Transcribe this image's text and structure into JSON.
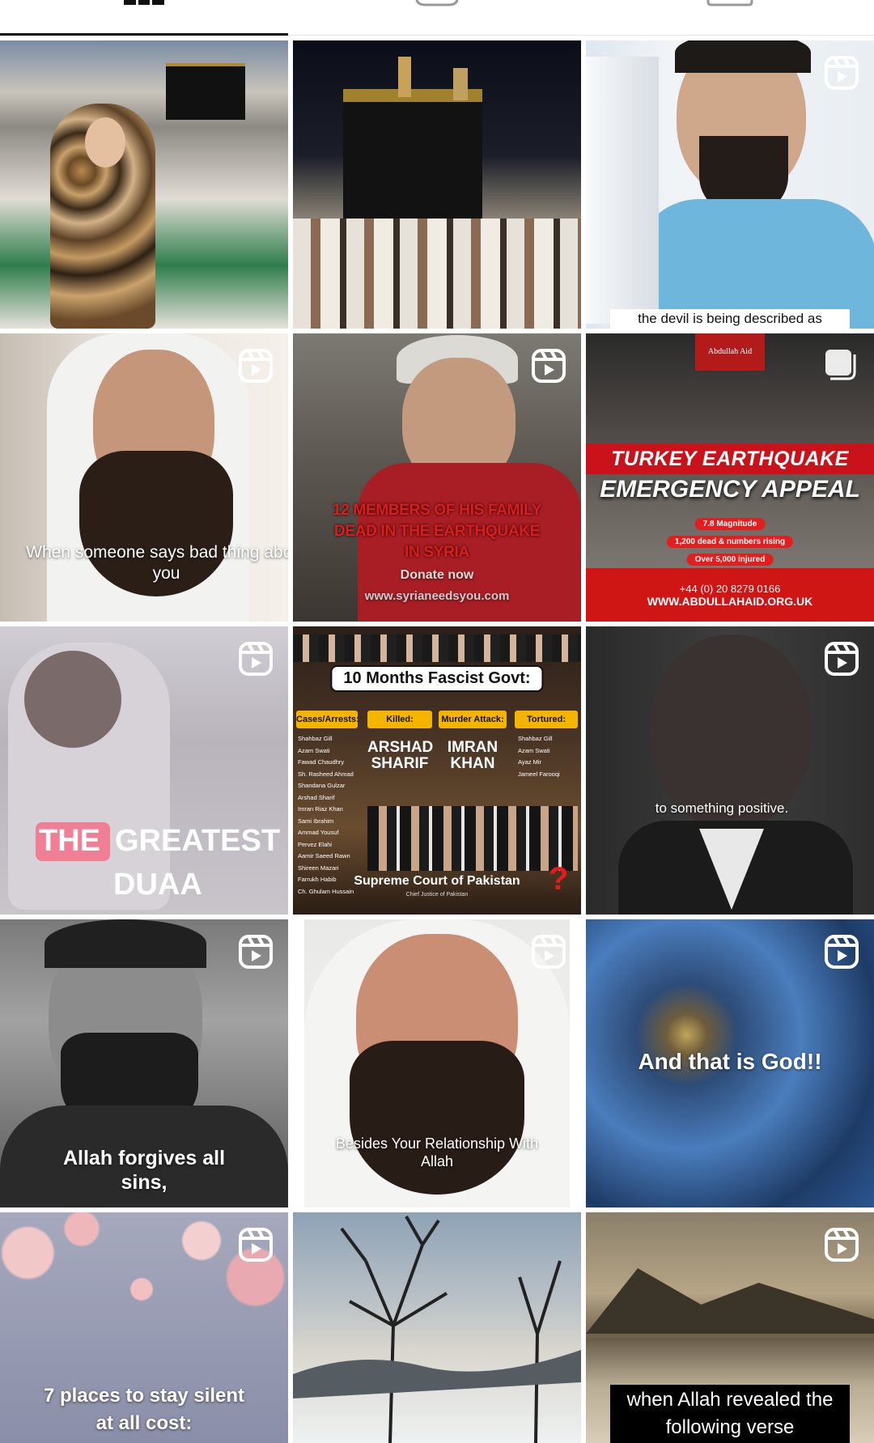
{
  "tabs": [
    {
      "name": "grid",
      "icon": "grid-icon",
      "active": true
    },
    {
      "name": "reels",
      "icon": "reels-icon",
      "active": false
    },
    {
      "name": "tagged",
      "icon": "tagged-icon",
      "active": false
    }
  ],
  "posts": {
    "p03": {
      "caption": "the devil is being described as"
    },
    "p04": {
      "caption": "When someone says bad thing about you"
    },
    "p05": {
      "line1": "12 MEMBERS OF HIS FAMILY",
      "line2": "DEAD IN THE EARTHQUAKE",
      "line3": "IN SYRIA",
      "donate": "Donate now",
      "url": "www.syrianeedsyou.com"
    },
    "p06": {
      "logo": "Abdullah Aid",
      "title": "TURKEY EARTHQUAKE",
      "subtitle": "EMERGENCY APPEAL",
      "stat1": "7.8 Magnitude",
      "stat2": "1,200 dead & numbers rising",
      "stat3": "Over 5,000 injured",
      "phone": "+44 (0) 20 8279 0166",
      "web": "WWW.ABDULLAHAID.ORG.UK"
    },
    "p07": {
      "word1": "THE",
      "word2": "GREATEST",
      "word3": "DUAA"
    },
    "p08": {
      "title": "10 Months Fascist Govt:",
      "col1": "Cases/Arrests:",
      "col2": "Killed:",
      "col3": "Murder Attack:",
      "col4": "Tortured:",
      "cases": [
        "Shahbaz Gill",
        "Azam Swati",
        "Fawad Chaudhry",
        "Sh. Rasheed Ahmad",
        "Shandana Gulzar",
        "Arshad Sharif",
        "Imran Riaz Khan",
        "Sami Ibrahim",
        "Ammad Yousuf",
        "Pervez Elahi",
        "Aamir Saeed Rawn",
        "Shireen Mazari",
        "Farrukh Habib",
        "Ch. Ghulam Hussain"
      ],
      "killed": "ARSHAD SHARIF",
      "attack": "IMRAN KHAN",
      "tortured": [
        "Shahbaz Gill",
        "Azam Swati",
        "Ayaz Mir",
        "Jameel Farooqi"
      ],
      "footer": "Supreme Court of Pakistan",
      "footer_sub": "Chief Justice of Pakistan"
    },
    "p09": {
      "caption": "to something positive."
    },
    "p10": {
      "caption": "Allah forgives all sins,"
    },
    "p11": {
      "caption": "Besides Your Relationship With Allah"
    },
    "p12": {
      "caption": "And that is God!!"
    },
    "p13": {
      "caption": "7 places to stay silent at all cost:"
    },
    "p15": {
      "caption": "when Allah revealed the following verse"
    }
  },
  "colors": {
    "accent": "#111111",
    "reel_icon": "#ffffff",
    "red": "#d01515",
    "gold": "#f4b400"
  }
}
